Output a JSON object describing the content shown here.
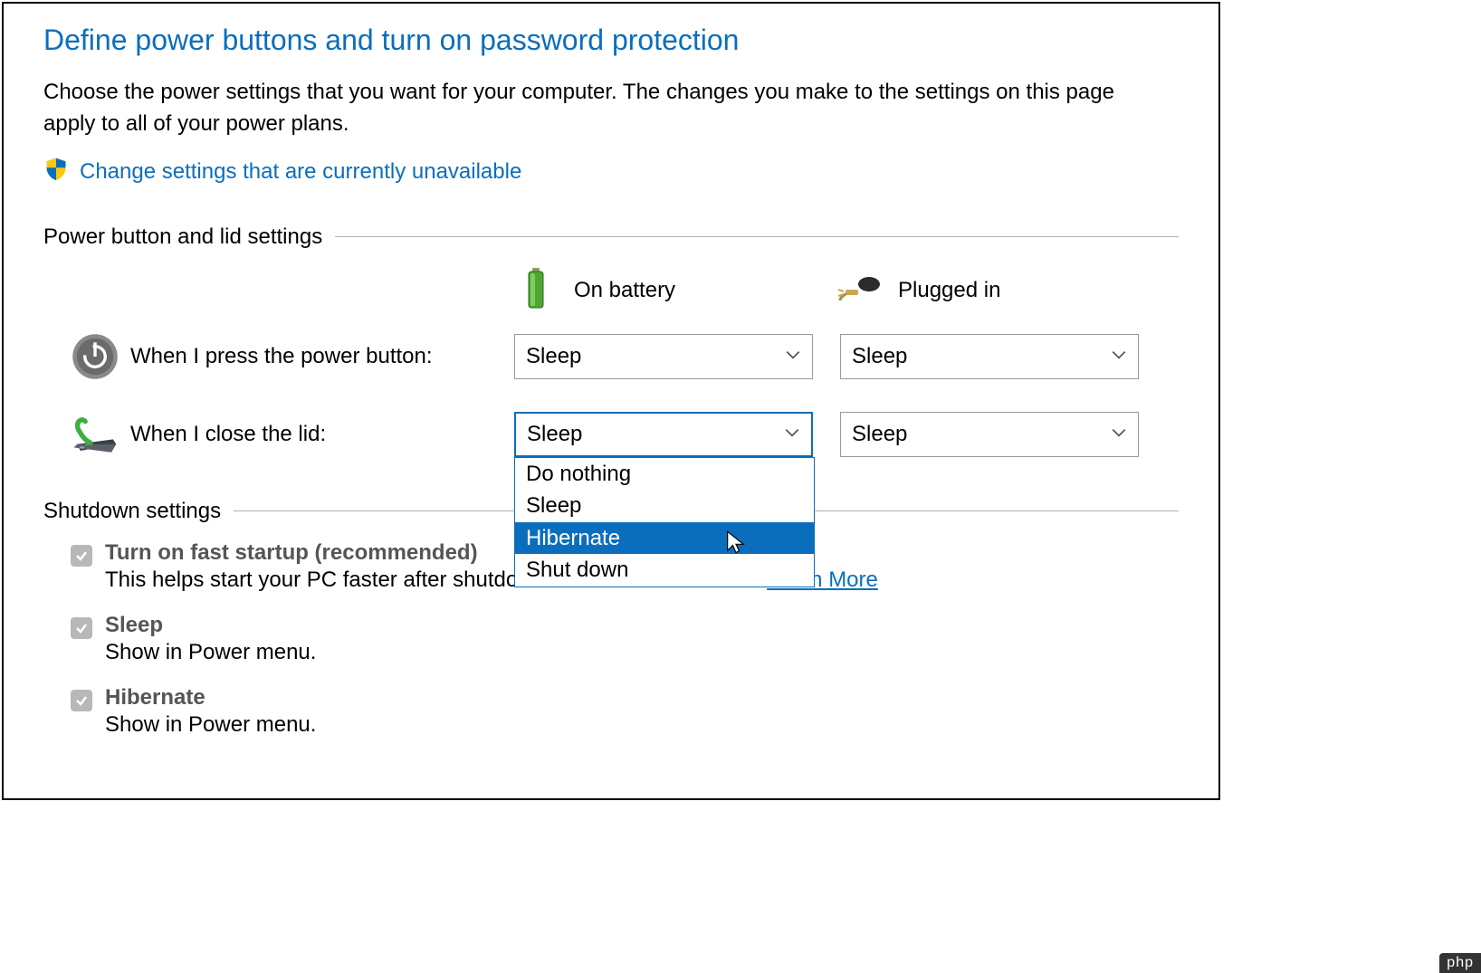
{
  "title": "Define power buttons and turn on password protection",
  "description": "Choose the power settings that you want for your computer. The changes you make to the settings on this page apply to all of your power plans.",
  "admin_link": "Change settings that are currently unavailable",
  "section_power": "Power button and lid settings",
  "columns": {
    "battery": "On battery",
    "plugged": "Plugged in"
  },
  "rows": {
    "power_button": {
      "label": "When I press the power button:",
      "battery_value": "Sleep",
      "plugged_value": "Sleep"
    },
    "close_lid": {
      "label": "When I close the lid:",
      "battery_value": "Sleep",
      "plugged_value": "Sleep",
      "options": [
        "Do nothing",
        "Sleep",
        "Hibernate",
        "Shut down"
      ],
      "highlighted": "Hibernate"
    }
  },
  "section_shutdown": "Shutdown settings",
  "shutdown_items": {
    "fast_startup": {
      "label": "Turn on fast startup (recommended)",
      "sub": "This helps start your PC faster after shutdown. Restart isn't affected. ",
      "link": "Learn More"
    },
    "sleep": {
      "label": "Sleep",
      "sub": "Show in Power menu."
    },
    "hibernate": {
      "label": "Hibernate",
      "sub": "Show in Power menu."
    }
  },
  "watermark": "php"
}
